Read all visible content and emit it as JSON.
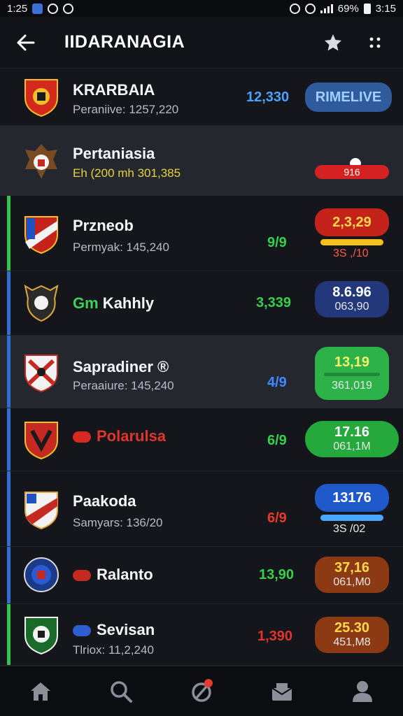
{
  "status_bar": {
    "time_left": "1:25",
    "battery": "69%",
    "time_right": "3:15"
  },
  "header": {
    "title": "IIDARANAGIA"
  },
  "rows": [
    {
      "name": "KRARBAIA",
      "sub": "Peraniive: 1257,220",
      "score": "12,330",
      "score_color": "#4aa3ff",
      "pill_top": "RIMELIVE",
      "pill_color": "#2f5a9c",
      "accent": ""
    },
    {
      "name": "Pertaniasia",
      "sub": "Eh (200 mh 301,385",
      "pill_top": "916",
      "pill_color": "#d42121",
      "accent": ""
    },
    {
      "name": "Przneob",
      "sub": "Permyak: 145,240",
      "score": "9/9",
      "score_color": "#35d14a",
      "pill_top": "2,3,29",
      "pill_color": "#c4231c",
      "under": "3S ,/10",
      "bar_color": "#f3c21c",
      "accent": "#35c24a"
    },
    {
      "name": "Gm Kahhly",
      "score": "3,339",
      "score_color": "#35d14a",
      "pill_top": "8.6.96",
      "pill_bottom": "063,90",
      "pill_color": "#22387a",
      "accent": "#2f6fd4"
    },
    {
      "name": "Sapradiner ®",
      "sub": "Peraaiure: 145,240",
      "score": "4/9",
      "score_color": "#3f88ff",
      "pill_top": "13,19",
      "pill_bottom": "361,019",
      "pill_color": "#2db24a",
      "accent": "#2f6fd4"
    },
    {
      "name": "Polarulsa",
      "score": "6/9",
      "score_color": "#35d14a",
      "pill_top": "17.16",
      "pill_bottom": "061,1M",
      "pill_color": "#25a83c",
      "accent": "#2f6fd4",
      "name_color": "#e0352b",
      "tag": "#d52a22"
    },
    {
      "name": "Paakoda",
      "sub": "Samyars: 136/20",
      "score": "6/9",
      "score_color": "#e53a2e",
      "pill_top": "13176",
      "pill_color": "#1f59c9",
      "under": "3S /02",
      "bar_color": "#49a6ff",
      "accent": "#2f6fd4"
    },
    {
      "name": "Ralanto",
      "score": "13,90",
      "score_color": "#35d14a",
      "pill_top": "37,16",
      "pill_bottom": "061,M0",
      "pill_color": "#8b3a14",
      "accent": "#2f6fd4",
      "tag": "#c42a22"
    },
    {
      "name": "Sevisan",
      "sub": "Tlriox: 11,2,240",
      "score": "1,390",
      "score_color": "#e0352b",
      "pill_top": "25.30",
      "pill_bottom": "451,M8",
      "pill_color": "#8b3a14",
      "accent": "#35c24a",
      "tag": "#2d5fd1"
    }
  ],
  "nav": [
    "home-icon",
    "search-icon",
    "notification-icon",
    "inbox-icon",
    "profile-icon"
  ],
  "colors": {
    "background": "#14161b",
    "highlight": "#24272e"
  }
}
